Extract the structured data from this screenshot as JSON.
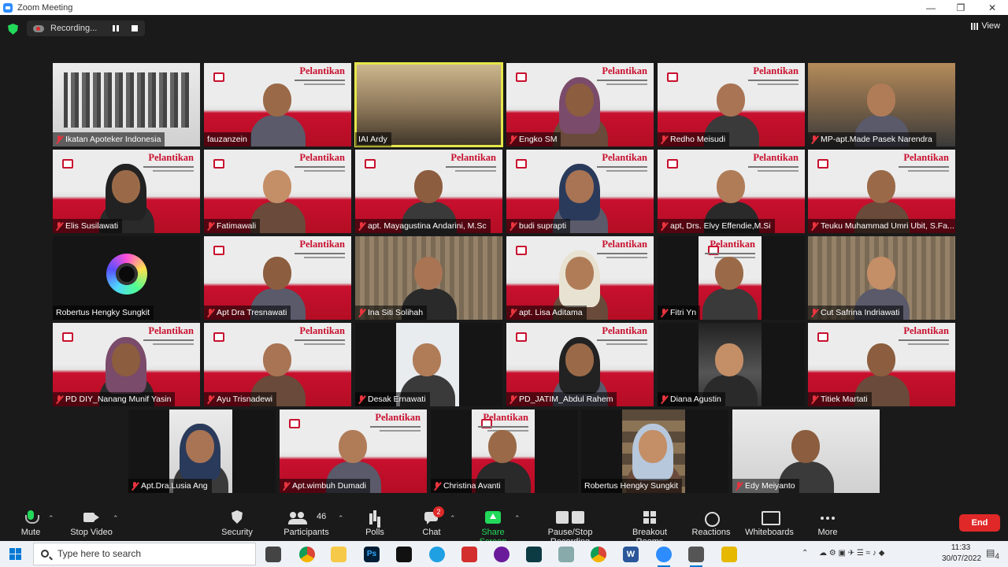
{
  "window": {
    "title": "Zoom Meeting"
  },
  "recording": {
    "label": "Recording..."
  },
  "view": {
    "label": "View"
  },
  "participants": [
    {
      "name": "Ikatan Apoteker Indonesia",
      "bg": "crowd",
      "muted": true
    },
    {
      "name": "fauzanzein",
      "bg": "banner",
      "muted": false
    },
    {
      "name": "IAI Ardy",
      "bg": "room",
      "muted": false,
      "active": true
    },
    {
      "name": "Engko SM",
      "bg": "banner",
      "muted": true
    },
    {
      "name": "Redho Meisudi",
      "bg": "banner",
      "muted": true
    },
    {
      "name": "MP-apt.Made Pasek Narendra",
      "bg": "photo",
      "muted": true
    },
    {
      "name": "Elis Susilawati",
      "bg": "banner",
      "muted": true
    },
    {
      "name": "Fatimawali",
      "bg": "banner",
      "muted": true
    },
    {
      "name": "apt. Mayagustina Andarini, M.Sc",
      "bg": "banner",
      "muted": true
    },
    {
      "name": "budi suprapti",
      "bg": "banner",
      "muted": true
    },
    {
      "name": "apt, Drs. Elvy Effendie,M.Si",
      "bg": "banner",
      "muted": true
    },
    {
      "name": "Teuku Muhammad Umri Ubit, S.Fa...",
      "bg": "banner",
      "muted": true
    },
    {
      "name": "Robertus Hengky Sungkit",
      "bg": "lens",
      "muted": false
    },
    {
      "name": "Apt Dra Tresnawati",
      "bg": "banner",
      "muted": true
    },
    {
      "name": "Ina Siti Solihah",
      "bg": "curtain",
      "muted": true
    },
    {
      "name": "apt. Lisa Aditama",
      "bg": "banner",
      "muted": true
    },
    {
      "name": "Fitri Yn",
      "bg": "banner-narrow",
      "muted": true
    },
    {
      "name": "Cut Safrina Indriawati",
      "bg": "curtain",
      "muted": true
    },
    {
      "name": "PD DIY_Nanang Munif Yasin",
      "bg": "banner",
      "muted": true
    },
    {
      "name": "Ayu Trisnadewi",
      "bg": "banner",
      "muted": true
    },
    {
      "name": "Desak Ernawati",
      "bg": "white-narrow",
      "muted": true
    },
    {
      "name": "PD_JATIM_Abdul Rahem",
      "bg": "banner",
      "muted": true
    },
    {
      "name": "Diana Agustin",
      "bg": "car-narrow",
      "muted": true
    },
    {
      "name": "Titiek Martati",
      "bg": "banner",
      "muted": true
    },
    {
      "name": "Apt.Dra.Lusia Ang",
      "bg": "wall-narrow",
      "muted": true
    },
    {
      "name": "Apt.wimbuh Dumadi",
      "bg": "banner",
      "muted": true
    },
    {
      "name": "Christina Avanti",
      "bg": "banner-narrow",
      "muted": true
    },
    {
      "name": "Robertus Hengky Sungkit",
      "bg": "shelf-narrow",
      "muted": false
    },
    {
      "name": "Edy Meiyanto",
      "bg": "whiteboard",
      "muted": true
    }
  ],
  "banner": {
    "title": "Pelantikan"
  },
  "toolbar": {
    "mute": "Mute",
    "stop_video": "Stop Video",
    "security": "Security",
    "participants": "Participants",
    "participant_count": "46",
    "polls": "Polls",
    "chat": "Chat",
    "chat_badge": "2",
    "share_screen": "Share Screen",
    "record": "Pause/Stop Recording",
    "breakout": "Breakout Rooms",
    "reactions": "Reactions",
    "whiteboards": "Whiteboards",
    "more": "More",
    "end": "End"
  },
  "taskbar": {
    "search_placeholder": "Type here to search",
    "time": "11:33",
    "date": "30/07/2022",
    "notif_count": "4"
  },
  "colors": {
    "accent_green": "#23d959",
    "end_red": "#e02828",
    "active_speaker": "#e6e64a",
    "banner_red": "#c8102e"
  }
}
